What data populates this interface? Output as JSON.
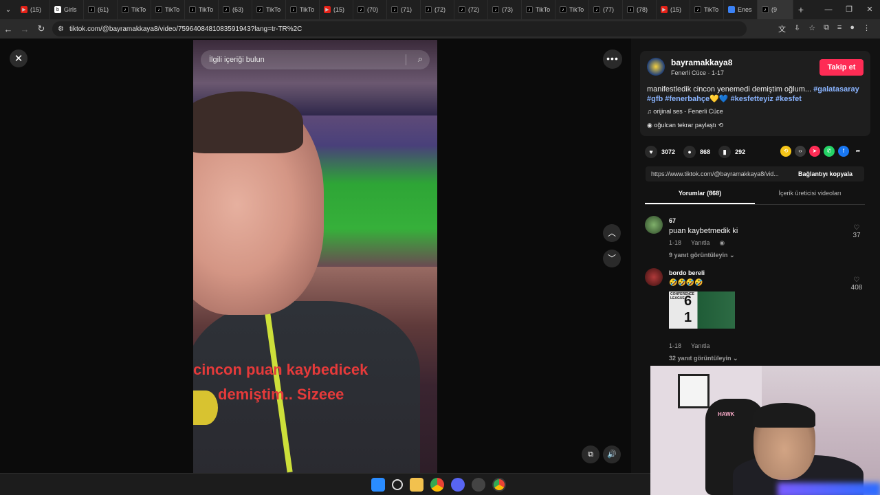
{
  "browser": {
    "tabs": [
      {
        "label": "(15)",
        "favicon": "youtube-icon"
      },
      {
        "label": "Girls",
        "favicon": "photobucket-icon"
      },
      {
        "label": "(61)",
        "favicon": "tiktok-icon"
      },
      {
        "label": "TikTo",
        "favicon": "tiktok-icon"
      },
      {
        "label": "TikTo",
        "favicon": "tiktok-icon"
      },
      {
        "label": "TikTo",
        "favicon": "tiktok-icon"
      },
      {
        "label": "(63)",
        "favicon": "tiktok-icon"
      },
      {
        "label": "TikTo",
        "favicon": "tiktok-icon"
      },
      {
        "label": "TikTo",
        "favicon": "tiktok-icon"
      },
      {
        "label": "(15)",
        "favicon": "youtube-icon"
      },
      {
        "label": "(70)",
        "favicon": "tiktok-icon"
      },
      {
        "label": "(71)",
        "favicon": "tiktok-icon"
      },
      {
        "label": "(72)",
        "favicon": "tiktok-icon"
      },
      {
        "label": "(72)",
        "favicon": "tiktok-icon"
      },
      {
        "label": "(73)",
        "favicon": "tiktok-icon"
      },
      {
        "label": "TikTo",
        "favicon": "tiktok-icon"
      },
      {
        "label": "TikTo",
        "favicon": "tiktok-icon"
      },
      {
        "label": "(77)",
        "favicon": "tiktok-icon"
      },
      {
        "label": "(78)",
        "favicon": "tiktok-icon"
      },
      {
        "label": "(15)",
        "favicon": "youtube-icon"
      },
      {
        "label": "TikTo",
        "favicon": "tiktok-icon"
      },
      {
        "label": "Enes",
        "favicon": "generic-icon"
      },
      {
        "label": "(9",
        "favicon": "tiktok-icon",
        "active": true
      }
    ],
    "url": "tiktok.com/@bayramakkaya8/video/7596408481083591943?lang=tr-TR%2C"
  },
  "video": {
    "search_placeholder": "İlgili içeriği bulun",
    "caption_line1": "cincon puan kaybedicek",
    "caption_line2": "demiştim.. Sizeee"
  },
  "author": {
    "username": "bayramakkaya8",
    "subtitle": "Fenerli Cüce · 1-17",
    "follow_label": "Takip et",
    "description": "manifestledik cincon yenemedi demiştim oğlum... ",
    "hashtags_line1": "#galatasaray",
    "hashtags_line2": "#gfb #fenerbahçe",
    "hashtags_line3": "#kesfetteyiz #kesfet",
    "music": "orijinal ses - Fenerli Cüce",
    "repost": "oğulcan tekrar paylaştı"
  },
  "stats": {
    "likes": "3072",
    "comments": "868",
    "saves": "292"
  },
  "link": {
    "url": "https://www.tiktok.com/@bayramakkaya8/vid...",
    "copy_label": "Bağlantıyı kopyala"
  },
  "tabs": {
    "comments": "Yorumlar (868)",
    "creator_videos": "İçerik üreticisi videoları"
  },
  "comments": [
    {
      "name": "67",
      "text": "puan kaybetmedik ki",
      "date": "1-18",
      "reply": "Yanıtla",
      "replies": "9 yanıt görüntüleyin",
      "likes": "37"
    },
    {
      "name": "bordo bereli",
      "text": "🤣🤣🤣🤣",
      "date": "1-18",
      "reply": "Yanıtla",
      "replies": "32 yanıt görüntüleyin",
      "likes": "408",
      "sticker_score_top": "6",
      "sticker_score_bottom": "1",
      "sticker_title": "CONFERENCE LEAGUE"
    }
  ],
  "webcam": {
    "chair_brand": "HAWK"
  },
  "colors": {
    "accent": "#fe2c55",
    "hashtag": "#8ab4ff"
  }
}
